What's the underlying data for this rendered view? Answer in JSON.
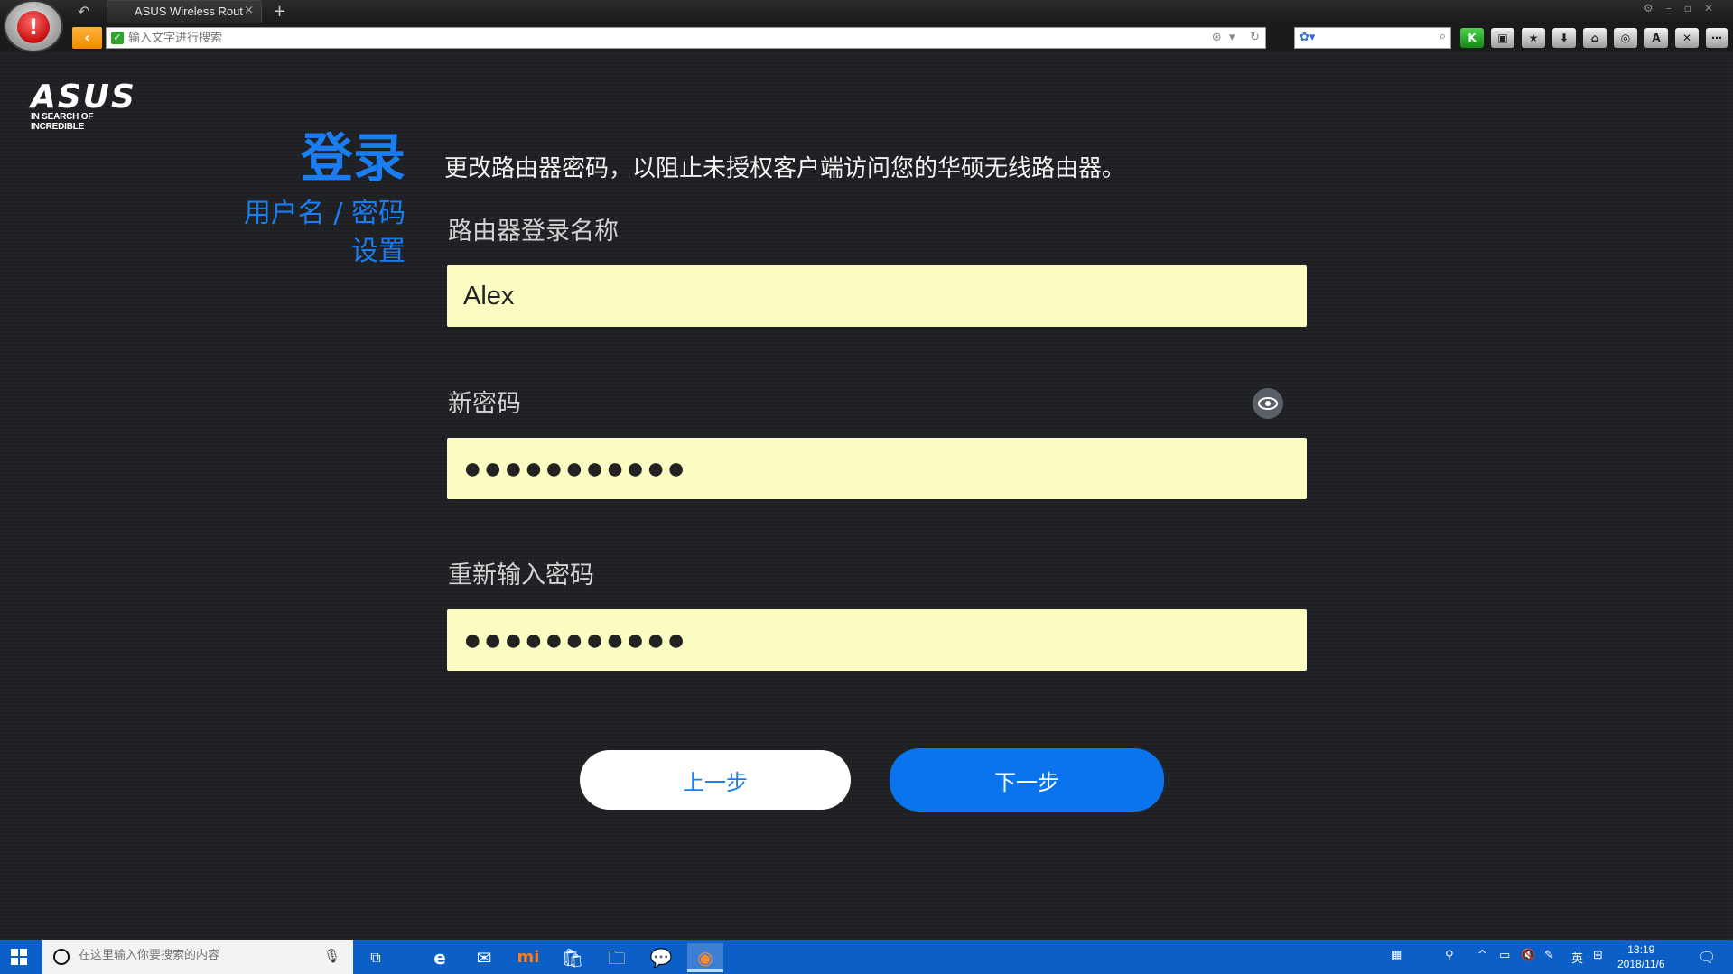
{
  "browser": {
    "tab_title": "ASUS Wireless Rout",
    "tab_close": "×",
    "new_tab": "+",
    "address_placeholder": "输入文字进行搜索",
    "toolbar_buttons": [
      "K",
      "lock",
      "star",
      "download",
      "gamepad",
      "camera",
      "A",
      "X",
      "more"
    ]
  },
  "page": {
    "brand": "ASUS",
    "brand_tagline": "IN SEARCH OF INCREDIBLE",
    "side_title": "登录",
    "side_subtitle_line1": "用户名 / 密码",
    "side_subtitle_line2": "设置",
    "description": "更改路由器密码，以阻止未授权客户端访问您的华硕无线路由器。",
    "username_label": "路由器登录名称",
    "username_value": "Alex",
    "new_password_label": "新密码",
    "new_password_value": "●●●●●●●●●●●",
    "confirm_password_label": "重新输入密码",
    "confirm_password_value": "●●●●●●●●●●●",
    "prev_button": "上一步",
    "next_button": "下一步",
    "accent_color": "#1a7ef2",
    "field_color": "#fbfcc2"
  },
  "taskbar": {
    "search_placeholder": "在这里输入你要搜索的内容",
    "ime_lang": "英",
    "time": "13:19",
    "date": "2018/11/6"
  }
}
